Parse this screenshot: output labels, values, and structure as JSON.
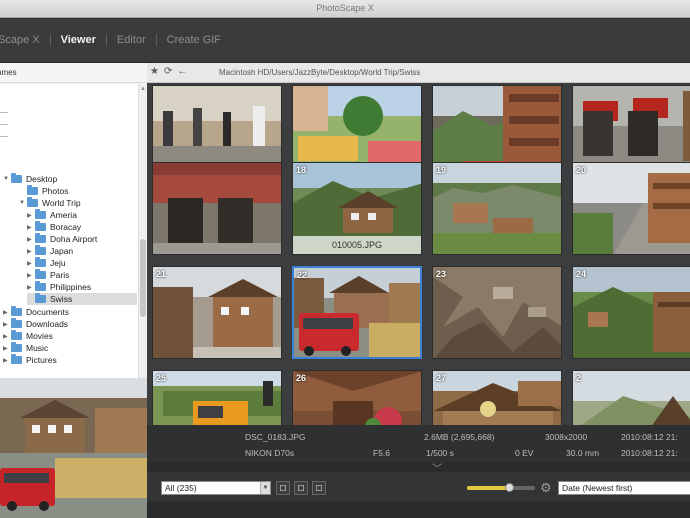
{
  "window": {
    "title": "PhotoScape X"
  },
  "nav": {
    "tabs": [
      {
        "label": "Scape X"
      },
      {
        "label": "Viewer"
      },
      {
        "label": "Editor"
      },
      {
        "label": "Create GIF"
      }
    ],
    "active_tab": "Viewer"
  },
  "sidebar": {
    "header": "ames",
    "tree": [
      {
        "label": "Desktop"
      },
      {
        "label": "Photos"
      },
      {
        "label": "World Trip"
      },
      {
        "label": "Ameria"
      },
      {
        "label": "Boracay"
      },
      {
        "label": "Doha Airport"
      },
      {
        "label": "Japan"
      },
      {
        "label": "Jeju"
      },
      {
        "label": "Paris"
      },
      {
        "label": "Philippines"
      },
      {
        "label": "Swiss"
      },
      {
        "label": "Documents"
      },
      {
        "label": "Downloads"
      },
      {
        "label": "Movies"
      },
      {
        "label": "Music"
      },
      {
        "label": "Pictures"
      }
    ],
    "selected": "Swiss"
  },
  "toolbar": {
    "path": "Macintosh HD/Users/JazzByte/Desktop/World Trip/Swiss"
  },
  "grid": {
    "cells": [
      {
        "num": ""
      },
      {
        "num": ""
      },
      {
        "num": ""
      },
      {
        "num": ""
      },
      {
        "num": ""
      },
      {
        "num": "18",
        "filename": "010005.JPG"
      },
      {
        "num": "19"
      },
      {
        "num": "20"
      },
      {
        "num": "21"
      },
      {
        "num": "22"
      },
      {
        "num": "23"
      },
      {
        "num": "24"
      },
      {
        "num": "25"
      },
      {
        "num": "26"
      },
      {
        "num": "27"
      },
      {
        "num": "2"
      }
    ],
    "selected_index": 9
  },
  "info": {
    "filename": "DSC_0183.JPG",
    "size": "2.6MB (2,695,668)",
    "dimensions": "3008x2000",
    "date": "2010:08:12 21:",
    "camera": "NIKON D70s",
    "aperture": "F5.6",
    "shutter": "1/500 s",
    "exposure": "0 EV",
    "focal": "30.0 mm",
    "date2": "2010:08:12 21:"
  },
  "bottom": {
    "filter": "All (235)",
    "sort": "Date (Newest first)",
    "zoom_level": 0.62
  },
  "colors": {
    "accent": "#3b82d6",
    "slider": "#e6c63a"
  }
}
